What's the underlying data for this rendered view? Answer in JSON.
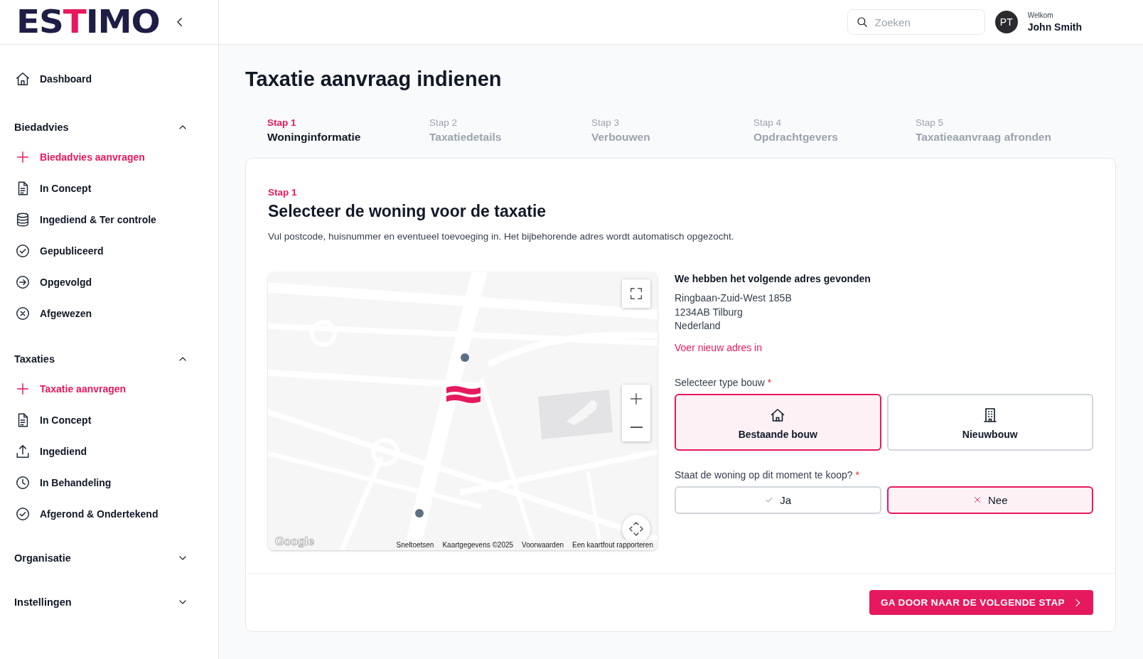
{
  "logo": {
    "parts": [
      {
        "text": "ES",
        "accent": false
      },
      {
        "text": "T",
        "accent": true
      },
      {
        "text": "IMO",
        "accent": false
      }
    ]
  },
  "search": {
    "placeholder": "Zoeken"
  },
  "user": {
    "initials": "PT",
    "greeting": "Welkom",
    "name": "John Smith"
  },
  "sidebar": {
    "items": [
      {
        "label": "Dashboard",
        "kind": "home"
      }
    ],
    "sections": [
      {
        "title": "Biedadvies",
        "expanded": true,
        "items": [
          {
            "label": "Biedadvies aanvragen",
            "kind": "add"
          },
          {
            "label": "In Concept",
            "kind": "document"
          },
          {
            "label": "Ingediend & Ter controle",
            "kind": "database"
          },
          {
            "label": "Gepubliceerd",
            "kind": "check"
          },
          {
            "label": "Opgevolgd",
            "kind": "arrow"
          },
          {
            "label": "Afgewezen",
            "kind": "cross"
          }
        ]
      },
      {
        "title": "Taxaties",
        "expanded": true,
        "items": [
          {
            "label": "Taxatie aanvragen",
            "kind": "add"
          },
          {
            "label": "In Concept",
            "kind": "document"
          },
          {
            "label": "Ingediend",
            "kind": "upload"
          },
          {
            "label": "In Behandeling",
            "kind": "clock"
          },
          {
            "label": "Afgerond & Ondertekend",
            "kind": "check"
          }
        ]
      },
      {
        "title": "Organisatie",
        "expanded": false
      },
      {
        "title": "Instellingen",
        "expanded": false
      }
    ]
  },
  "page_title": "Taxatie aanvraag indienen",
  "steps": [
    {
      "number": "Stap 1",
      "title": "Woninginformatie",
      "selected": true
    },
    {
      "number": "Stap 2",
      "title": "Taxatiedetails",
      "selected": false
    },
    {
      "number": "Stap 3",
      "title": "Verbouwen",
      "selected": false
    },
    {
      "number": "Stap 4",
      "title": "Opdrachtgevers",
      "selected": false
    },
    {
      "number": "Stap 5",
      "title": "Taxatieaanvraag afronden",
      "selected": false
    }
  ],
  "card": {
    "step_label": "Stap 1",
    "heading": "Selecteer de woning voor de taxatie",
    "description": "Vul postcode, huisnummer en eventueel toevoeging in. Het bijbehorende adres wordt automatisch opgezocht."
  },
  "map": {
    "logo": "Google",
    "attribution": [
      "Sneltoetsen",
      "Kaartgegevens ©2025",
      "Voorwaarden",
      "Een kaartfout rapporteren"
    ]
  },
  "address": {
    "heading": "We hebben het volgende adres gevonden",
    "lines": [
      "Ringbaan-Zuid-West 185B",
      "1234AB Tilburg",
      "Nederland"
    ],
    "link": "Voer nieuw adres in"
  },
  "build_type": {
    "label": "Selecteer type bouw",
    "required_mark": "*",
    "options": [
      {
        "label": "Bestaande bouw",
        "kind": "house",
        "selected": true
      },
      {
        "label": "Nieuwbouw",
        "kind": "building",
        "selected": false
      }
    ]
  },
  "for_sale": {
    "label": "Staat de woning op dit moment te koop?",
    "required_mark": "*",
    "options": [
      {
        "label": "Ja",
        "kind": "yes",
        "selected": false
      },
      {
        "label": "Nee",
        "kind": "no",
        "selected": true
      }
    ]
  },
  "next_button": {
    "label": "GA DOOR NAAR DE VOLGENDE STAP"
  }
}
